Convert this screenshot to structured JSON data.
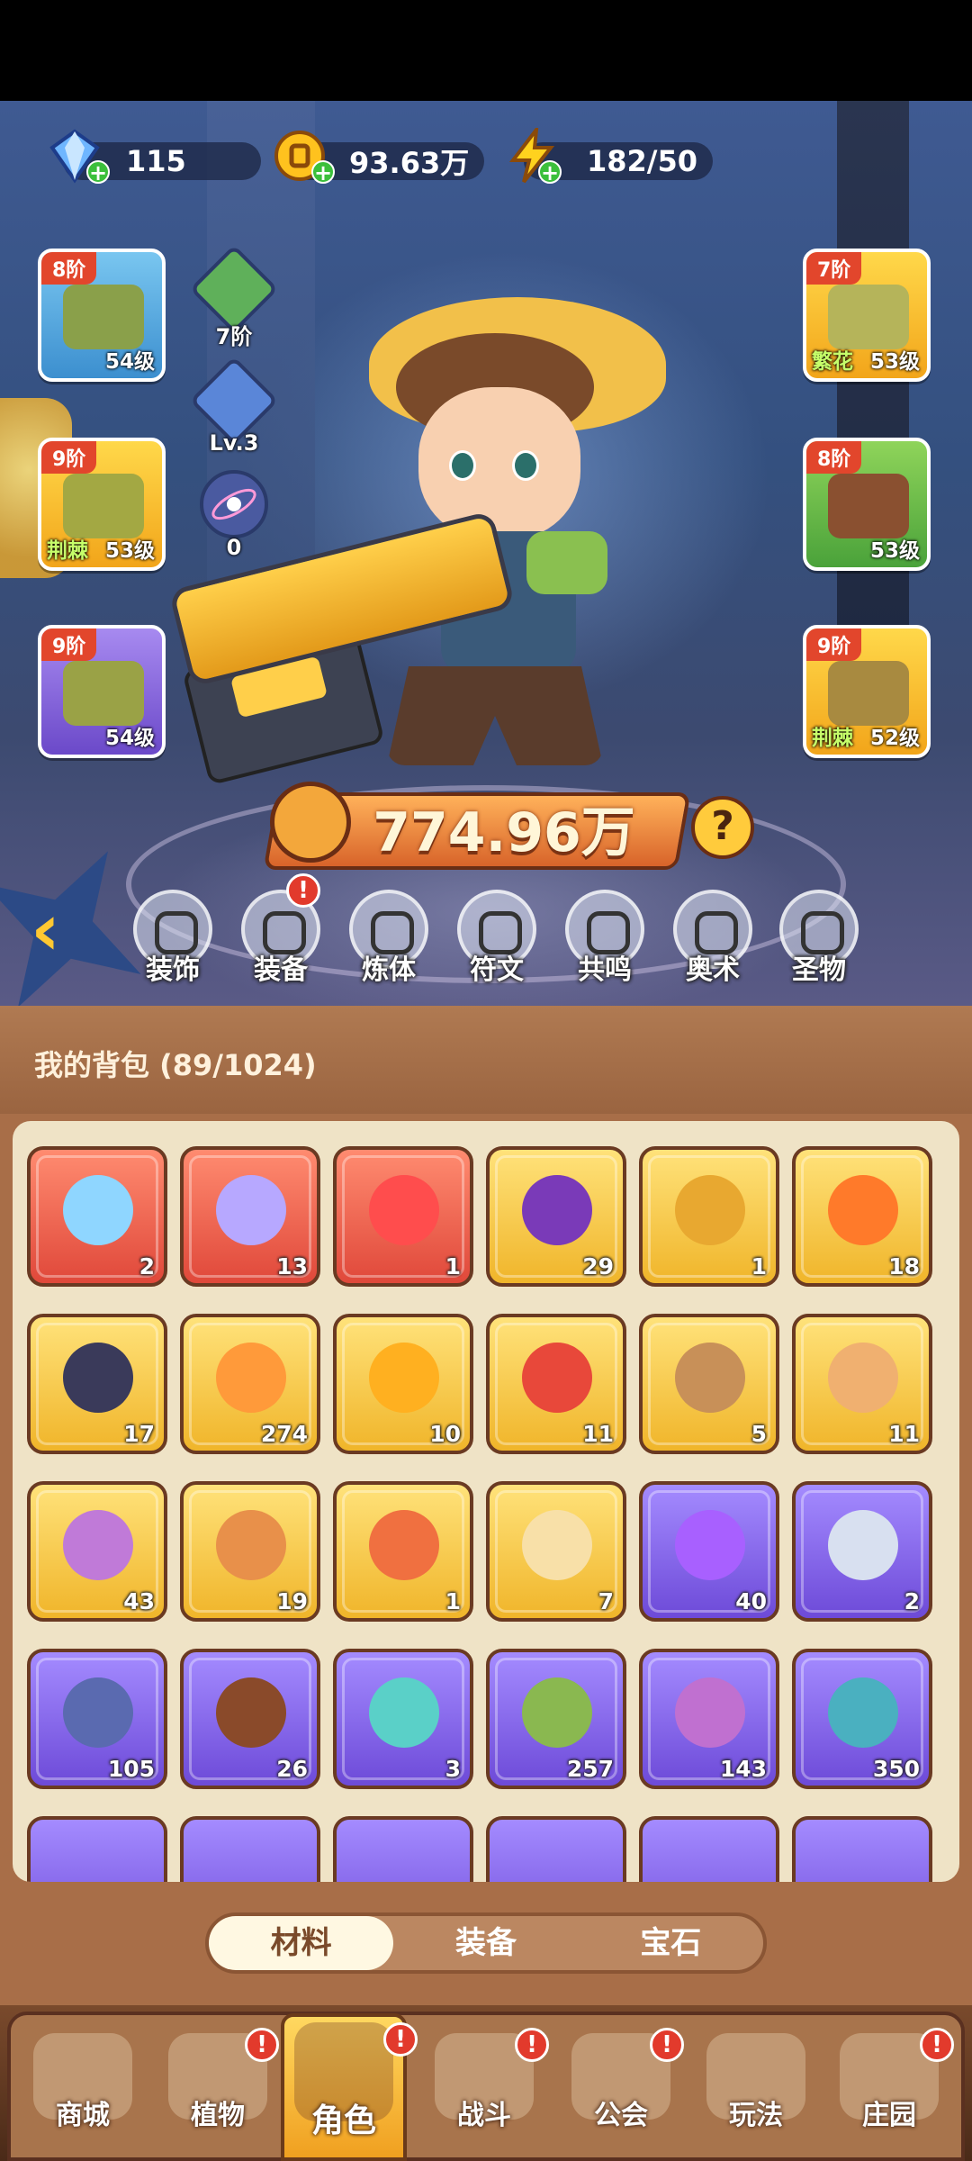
{
  "currency": {
    "diamond": {
      "icon": "diamond-icon",
      "value": "115"
    },
    "gold": {
      "icon": "gold-coin-icon",
      "value": "93.63万"
    },
    "energy": {
      "icon": "lightning-icon",
      "value": "182/50"
    }
  },
  "equipment": {
    "hat": {
      "tier": "8阶",
      "level": "54级",
      "set": ""
    },
    "gloves": {
      "tier": "9阶",
      "level": "53级",
      "set": "荆棘"
    },
    "pants": {
      "tier": "9阶",
      "level": "54级",
      "set": ""
    },
    "armor": {
      "tier": "7阶",
      "level": "53级",
      "set": "繁花"
    },
    "belt": {
      "tier": "8阶",
      "level": "53级",
      "set": ""
    },
    "boots": {
      "tier": "9阶",
      "level": "52级",
      "set": "荆棘"
    }
  },
  "side_slots": {
    "rune_tier": "7阶",
    "crystal_level": "Lv.3",
    "orb_count": "0"
  },
  "power": {
    "value": "774.96万",
    "help": "?"
  },
  "functions": [
    "装饰",
    "装备",
    "炼体",
    "符文",
    "共鸣",
    "奥术",
    "圣物"
  ],
  "backpack": {
    "title": "我的背包 (89/1024)",
    "items": [
      {
        "icon": "star-crystal-icon",
        "rarity": "red",
        "count": "2"
      },
      {
        "icon": "moon-crystal-icon",
        "rarity": "red",
        "count": "13"
      },
      {
        "icon": "red-potion-icon",
        "rarity": "red",
        "count": "1"
      },
      {
        "icon": "skull-scroll-icon",
        "rarity": "gold",
        "count": "29"
      },
      {
        "icon": "golden-key-icon",
        "rarity": "gold",
        "count": "1"
      },
      {
        "icon": "fire-pyramid-icon",
        "rarity": "gold",
        "count": "18"
      },
      {
        "icon": "rune-stone-icon",
        "rarity": "gold",
        "count": "17"
      },
      {
        "icon": "sprout-potion-icon",
        "rarity": "gold",
        "count": "274"
      },
      {
        "icon": "gold-ore-icon",
        "rarity": "gold",
        "count": "10"
      },
      {
        "icon": "red-flower-icon",
        "rarity": "gold",
        "count": "11"
      },
      {
        "icon": "flower-pot-icon",
        "rarity": "gold",
        "count": "5"
      },
      {
        "icon": "cake-icon",
        "rarity": "gold",
        "count": "11"
      },
      {
        "icon": "purple-book-icon",
        "rarity": "gold",
        "count": "43"
      },
      {
        "icon": "jar-icon",
        "rarity": "gold",
        "count": "19"
      },
      {
        "icon": "orange-gem-icon",
        "rarity": "gold",
        "count": "1"
      },
      {
        "icon": "knot-emblem-icon",
        "rarity": "gold",
        "count": "7"
      },
      {
        "icon": "purple-potion-icon",
        "rarity": "purple",
        "count": "40"
      },
      {
        "icon": "silver-key-icon",
        "rarity": "purple",
        "count": "2"
      },
      {
        "icon": "lightning-badge-icon",
        "rarity": "purple",
        "count": "105"
      },
      {
        "icon": "brown-book-icon",
        "rarity": "purple",
        "count": "26"
      },
      {
        "icon": "leaf-icon",
        "rarity": "purple",
        "count": "3"
      },
      {
        "icon": "green-scroll-icon",
        "rarity": "purple",
        "count": "257"
      },
      {
        "icon": "purple-scroll-icon",
        "rarity": "purple",
        "count": "143"
      },
      {
        "icon": "teal-scroll-icon",
        "rarity": "purple",
        "count": "350"
      }
    ]
  },
  "tabs": [
    "材料",
    "装备",
    "宝石"
  ],
  "nav": [
    "商城",
    "植物",
    "角色",
    "战斗",
    "公会",
    "玩法",
    "庄园"
  ],
  "colors": {
    "accent_gold": "#ffc832",
    "rarity_red": "#e0483a",
    "rarity_gold": "#f0b52a",
    "rarity_purple": "#6d4ad8",
    "badge_red": "#e23a2c"
  }
}
